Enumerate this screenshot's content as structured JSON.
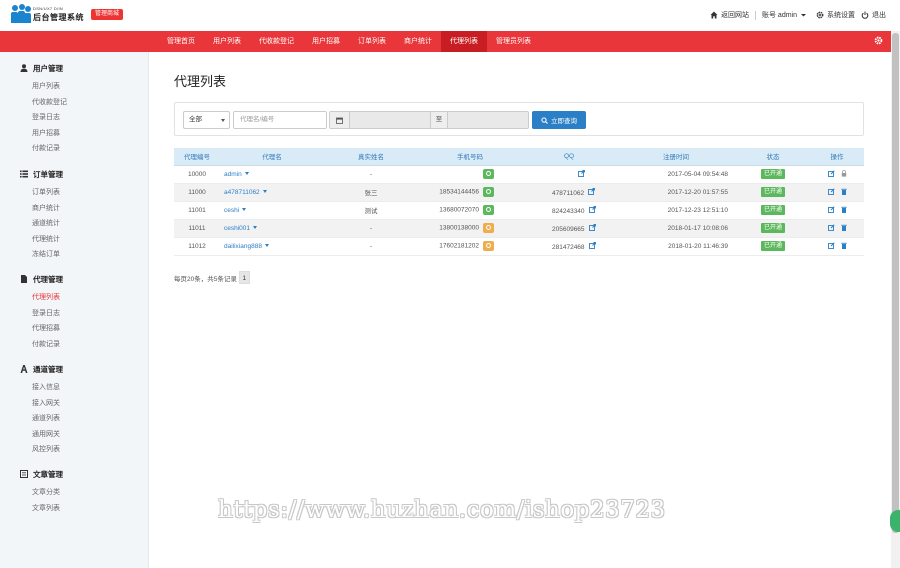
{
  "brand": {
    "logo_en": "DSN/UX7 D/IN",
    "logo_cn": "后台管理系统",
    "badge": "管理商城"
  },
  "topbar": {
    "home_link": "返回网站",
    "account_label": "账号 admin",
    "settings": "系统设置",
    "logout": "退出"
  },
  "nav": {
    "items": [
      {
        "label": "管理首页"
      },
      {
        "label": "用户列表"
      },
      {
        "label": "代收款登记"
      },
      {
        "label": "用户招募"
      },
      {
        "label": "订单列表"
      },
      {
        "label": "商户统计"
      },
      {
        "label": "代理列表"
      },
      {
        "label": "管理员列表"
      }
    ],
    "active_index": 6
  },
  "sidebar": {
    "groups": [
      {
        "title": "用户管理",
        "icon": "user-icon",
        "items": [
          "用户列表",
          "代收款登记",
          "登录日志",
          "用户招募",
          "付款记录"
        ]
      },
      {
        "title": "订单管理",
        "icon": "list-icon",
        "items": [
          "订单列表",
          "商户统计",
          "通道统计",
          "代理统计",
          "冻结订单"
        ]
      },
      {
        "title": "代理管理",
        "icon": "file-icon",
        "items": [
          "代理列表",
          "登录日志",
          "代理招募",
          "付款记录"
        ]
      },
      {
        "title": "通道管理",
        "icon": "font-icon",
        "items": [
          "接入信息",
          "接入网关",
          "通道列表",
          "通用网关",
          "风控列表"
        ]
      },
      {
        "title": "文章管理",
        "icon": "article-icon",
        "items": [
          "文章分类",
          "文章列表"
        ]
      }
    ],
    "active_item": "代理列表"
  },
  "main": {
    "title": "代理列表",
    "search": {
      "select_value": "全部",
      "input_placeholder": "代理名/编号",
      "date_separator": "至",
      "button_label": "立即查询"
    },
    "table": {
      "columns": [
        "代理编号",
        "代理名",
        "真实姓名",
        "手机号码",
        "QQ",
        "注册时间",
        "状态",
        "操作"
      ],
      "rows": [
        {
          "id": "10000",
          "name": "admin",
          "real_name": "-",
          "phone": "",
          "phone_icon": "green",
          "qq": "",
          "reg_time": "2017-05-04 09:54:48",
          "status": "已开通",
          "second_op": "lock-icon"
        },
        {
          "id": "11000",
          "name": "a478711062",
          "real_name": "张三",
          "phone": "18534144456",
          "phone_icon": "green",
          "qq": "478711062",
          "reg_time": "2017-12-20 01:57:55",
          "status": "已开通",
          "second_op": "trash-icon"
        },
        {
          "id": "11001",
          "name": "ceshi",
          "real_name": "测试",
          "phone": "13680072070",
          "phone_icon": "green",
          "qq": "824243340",
          "reg_time": "2017-12-23 12:51:10",
          "status": "已开通",
          "second_op": "trash-icon"
        },
        {
          "id": "11011",
          "name": "ceshi001",
          "real_name": "-",
          "phone": "13800138000",
          "phone_icon": "orange",
          "qq": "205609665",
          "reg_time": "2018-01-17 10:08:06",
          "status": "已开通",
          "second_op": "trash-icon"
        },
        {
          "id": "11012",
          "name": "dailixiang888",
          "real_name": "-",
          "phone": "17602181202",
          "phone_icon": "orange",
          "qq": "281472468",
          "reg_time": "2018-01-20 11:46:39",
          "status": "已开通",
          "second_op": "trash-icon"
        }
      ]
    },
    "pager": {
      "summary": "每页20条，共5条记录",
      "current": "1"
    }
  },
  "watermark": "https://www.huzhan.com/ishop23723",
  "colors": {
    "nav_red": "#e8363b",
    "nav_active": "#c81d22",
    "primary_blue": "#2b7fc6",
    "status_green": "#5cb85c",
    "warn_orange": "#f0ad4e",
    "table_head": "#d9ebf7"
  }
}
